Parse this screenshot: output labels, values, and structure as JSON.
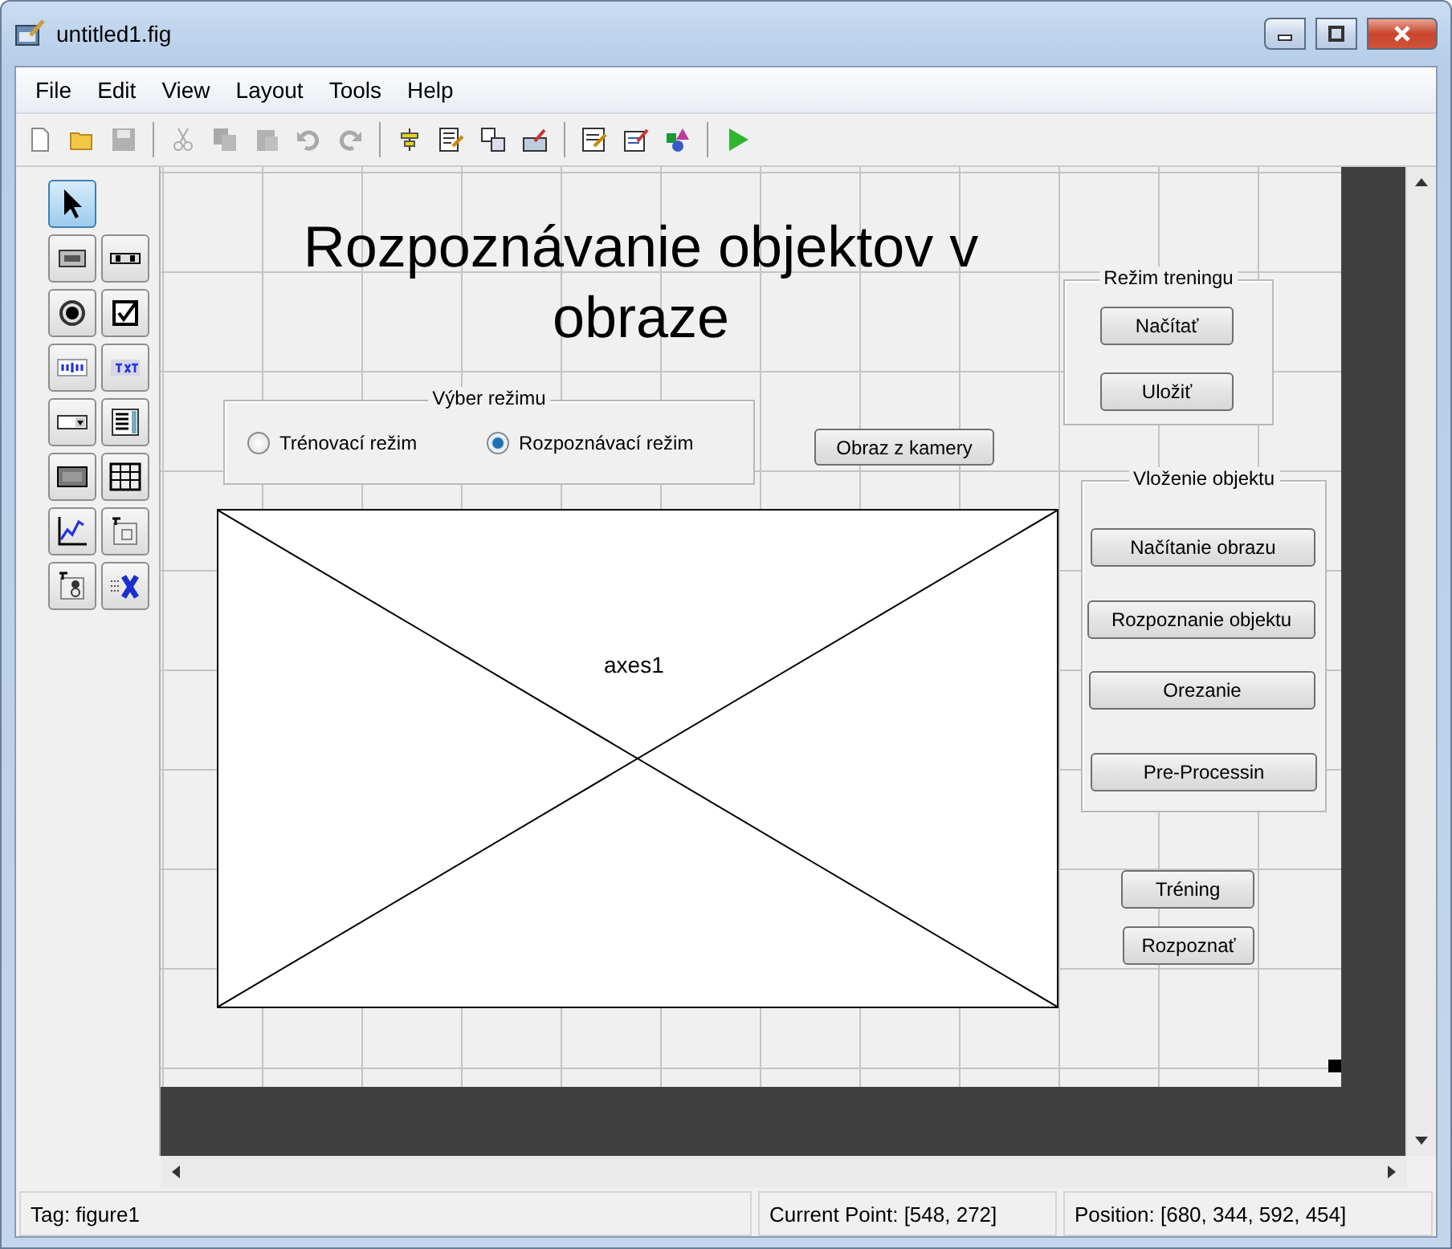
{
  "window": {
    "title": "untitled1.fig"
  },
  "menu": [
    "File",
    "Edit",
    "View",
    "Layout",
    "Tools",
    "Help"
  ],
  "toolbar": [
    {
      "kind": "new",
      "disabled": false
    },
    {
      "kind": "open",
      "disabled": false
    },
    {
      "kind": "save",
      "disabled": true
    },
    {
      "kind": "separator"
    },
    {
      "kind": "cut",
      "disabled": true
    },
    {
      "kind": "copy",
      "disabled": true
    },
    {
      "kind": "paste",
      "disabled": true
    },
    {
      "kind": "undo",
      "disabled": true
    },
    {
      "kind": "redo",
      "disabled": true
    },
    {
      "kind": "separator"
    },
    {
      "kind": "align",
      "disabled": false
    },
    {
      "kind": "menu-editor",
      "disabled": false
    },
    {
      "kind": "tab-order",
      "disabled": false
    },
    {
      "kind": "toolbar-editor",
      "disabled": false
    },
    {
      "kind": "separator"
    },
    {
      "kind": "editor",
      "disabled": false
    },
    {
      "kind": "inspector",
      "disabled": false
    },
    {
      "kind": "browser",
      "disabled": false
    },
    {
      "kind": "separator"
    },
    {
      "kind": "run",
      "disabled": false
    }
  ],
  "palette": [
    {
      "kind": "pointer",
      "selected": true
    },
    {
      "kind": "pushbutton",
      "selected": false
    },
    {
      "kind": "slider",
      "selected": false
    },
    {
      "kind": "radio",
      "selected": false
    },
    {
      "kind": "checkbox",
      "selected": false
    },
    {
      "kind": "edit",
      "selected": false
    },
    {
      "kind": "text",
      "selected": false
    },
    {
      "kind": "popup",
      "selected": false
    },
    {
      "kind": "listbox",
      "selected": false
    },
    {
      "kind": "toggle",
      "selected": false
    },
    {
      "kind": "table",
      "selected": false
    },
    {
      "kind": "axes",
      "selected": false
    },
    {
      "kind": "panel",
      "selected": false
    },
    {
      "kind": "buttongroup",
      "selected": false
    },
    {
      "kind": "activex",
      "selected": false
    }
  ],
  "canvas": {
    "title": "Rozpoznávanie objektov v obraze",
    "mode_panel": {
      "title": "Výber režimu",
      "options": [
        {
          "label": "Trénovací režim",
          "selected": false
        },
        {
          "label": "Rozpoznávací režim",
          "selected": true
        }
      ]
    },
    "camera_button": "Obraz z kamery",
    "axes": {
      "label": "axes1"
    },
    "training_panel": {
      "title": "Režim treningu",
      "buttons": [
        "Načítať",
        "Uložiť"
      ]
    },
    "object_panel": {
      "title": "Vloženie objektu",
      "buttons": [
        "Načítanie obrazu",
        "Rozpoznanie objektu",
        "Orezanie",
        "Pre-Processin"
      ]
    },
    "buttons": [
      "Tréning",
      "Rozpoznať"
    ]
  },
  "status_bar": {
    "tag": "Tag: figure1",
    "current_point": "Current Point:  [548, 272]",
    "position": "Position: [680, 344, 592, 454]"
  }
}
